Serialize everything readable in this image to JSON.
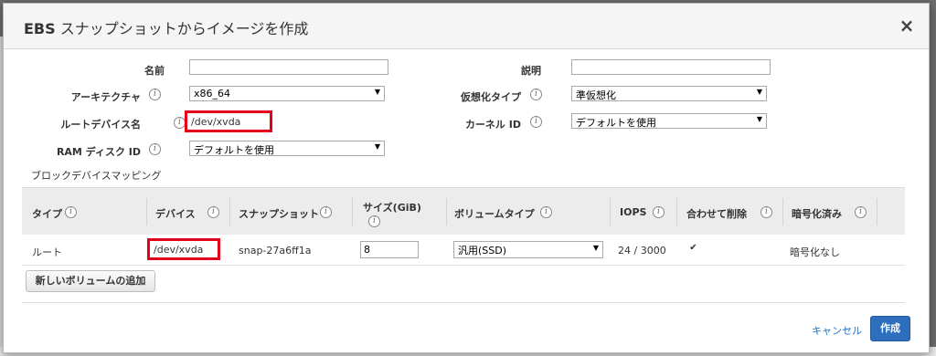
{
  "dialog": {
    "title_bold": "EBS",
    "title_rest": " スナップショットからイメージを作成",
    "close_glyph": "×"
  },
  "form": {
    "name_label": "名前",
    "name_value": "",
    "description_label": "説明",
    "description_value": "",
    "architecture_label": "アーキテクチャ",
    "architecture_value": "x86_64",
    "virtualization_label": "仮想化タイプ",
    "virtualization_value": "準仮想化",
    "root_device_label": "ルートデバイス名",
    "root_device_value": "/dev/xvda",
    "kernel_label": "カーネル ID",
    "kernel_value": "デフォルトを使用",
    "ramdisk_label": "RAM ディスク ID",
    "ramdisk_value": "デフォルトを使用"
  },
  "mapping": {
    "section_title": "ブロックデバイスマッピング",
    "headers": {
      "type": "タイプ",
      "device": "デバイス",
      "snapshot": "スナップショット",
      "size_line1": "サイズ(GiB)",
      "volume_type": "ボリュームタイプ",
      "iops": "IOPS",
      "delete_on_term": "合わせて削除",
      "encrypted": "暗号化済み"
    },
    "row": {
      "type": "ルート",
      "device": "/dev/xvda",
      "snapshot": "snap-27a6ff1a",
      "size": "8",
      "volume_type": "汎用(SSD)",
      "iops": "24 / 3000",
      "delete_checked": "✔",
      "encrypted": "暗号化なし"
    },
    "add_button": "新しいボリュームの追加"
  },
  "footer": {
    "cancel": "キャンセル",
    "create": "作成"
  },
  "icons": {
    "info": "i",
    "dropdown": "▼"
  },
  "colors": {
    "highlight": "#e2001a",
    "primary": "#2e6fbd",
    "link": "#1a73c8"
  }
}
